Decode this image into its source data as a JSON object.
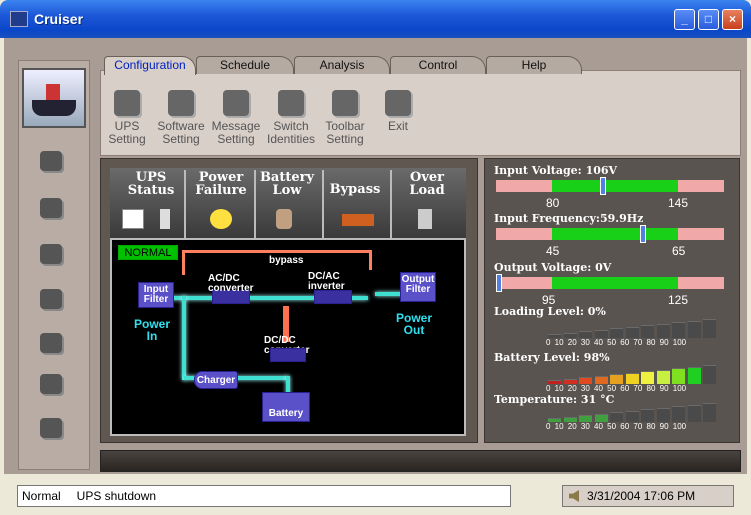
{
  "window": {
    "title": "Cruiser",
    "minimize": "_",
    "maximize": "□",
    "close": "×"
  },
  "tabs": [
    "Configuration",
    "Schedule",
    "Analysis",
    "Control",
    "Help"
  ],
  "toolbar": [
    {
      "line1": "UPS",
      "line2": "Setting"
    },
    {
      "line1": "Software",
      "line2": "Setting"
    },
    {
      "line1": "Message",
      "line2": "Setting"
    },
    {
      "line1": "Switch",
      "line2": "Identities"
    },
    {
      "line1": "Toolbar",
      "line2": "Setting"
    },
    {
      "line1": "Exit",
      "line2": ""
    }
  ],
  "status_header": {
    "ups_status": "UPS Status",
    "power_failure": "Power Failure",
    "battery_low": "Battery Low",
    "bypass": "Bypass",
    "over_load": "Over Load"
  },
  "diagram": {
    "mode": "NORMAL",
    "bypass": "bypass",
    "input_filter": "Input Filter",
    "acdc": "AC/DC converter",
    "dcac": "DC/AC inverter",
    "output_filter": "Output Filter",
    "dcdc": "DC/DC converter",
    "charger": "Charger",
    "battery": "Battery",
    "power_in": "Power In",
    "power_out": "Power Out"
  },
  "meters": {
    "input_voltage": {
      "label": "Input Voltage: 106V",
      "min": "80",
      "max": "145",
      "value": 106
    },
    "input_frequency": {
      "label": "Input Frequency:59.9Hz",
      "min": "45",
      "max": "65",
      "value": 59.9
    },
    "output_voltage": {
      "label": "Output Voltage: 0V",
      "min": "95",
      "max": "125",
      "value": 0
    },
    "loading_level": {
      "label": "Loading Level: 0%",
      "value": 0
    },
    "battery_level": {
      "label": "Battery Level: 98%",
      "value": 98
    },
    "temperature": {
      "label": "Temperature: 31 °C",
      "value": 31
    },
    "scale": "0 10 20 30 40 50 60 70 80 90 100"
  },
  "statusbar": {
    "state": "Normal",
    "message": "UPS shutdown",
    "datetime": "3/31/2004 17:06 PM"
  },
  "colors": {
    "title_bar": "#1c58d8",
    "normal": "#00c000",
    "range_ok": "#18d018",
    "range_bad": "#f0a8a8"
  }
}
